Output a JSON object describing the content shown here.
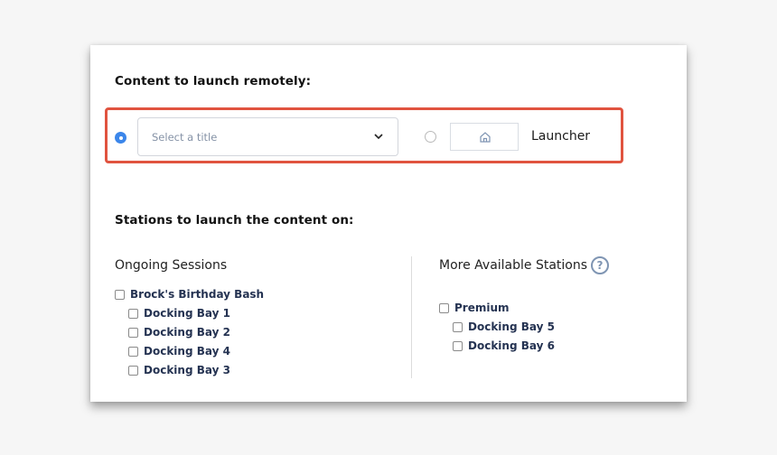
{
  "content_section": {
    "heading": "Content to launch remotely:",
    "options": {
      "title_select": {
        "selected": true,
        "placeholder": "Select a title"
      },
      "launcher": {
        "selected": false,
        "label": "Launcher",
        "icon": "home-icon"
      }
    },
    "accent_color": "#3b86ea",
    "highlight_color": "#e0533f"
  },
  "stations_section": {
    "heading": "Stations to launch the content on:",
    "ongoing": {
      "title": "Ongoing Sessions",
      "group": {
        "label": "Brock's Birthday Bash",
        "checked": false
      },
      "items": [
        {
          "label": "Docking Bay 1",
          "checked": false
        },
        {
          "label": "Docking Bay 2",
          "checked": false
        },
        {
          "label": "Docking Bay 4",
          "checked": false
        },
        {
          "label": "Docking Bay 3",
          "checked": false
        }
      ]
    },
    "available": {
      "title": "More Available Stations",
      "help_icon": "?",
      "group": {
        "label": "Premium",
        "checked": false
      },
      "items": [
        {
          "label": "Docking Bay 5",
          "checked": false
        },
        {
          "label": "Docking Bay 6",
          "checked": false
        }
      ]
    }
  }
}
